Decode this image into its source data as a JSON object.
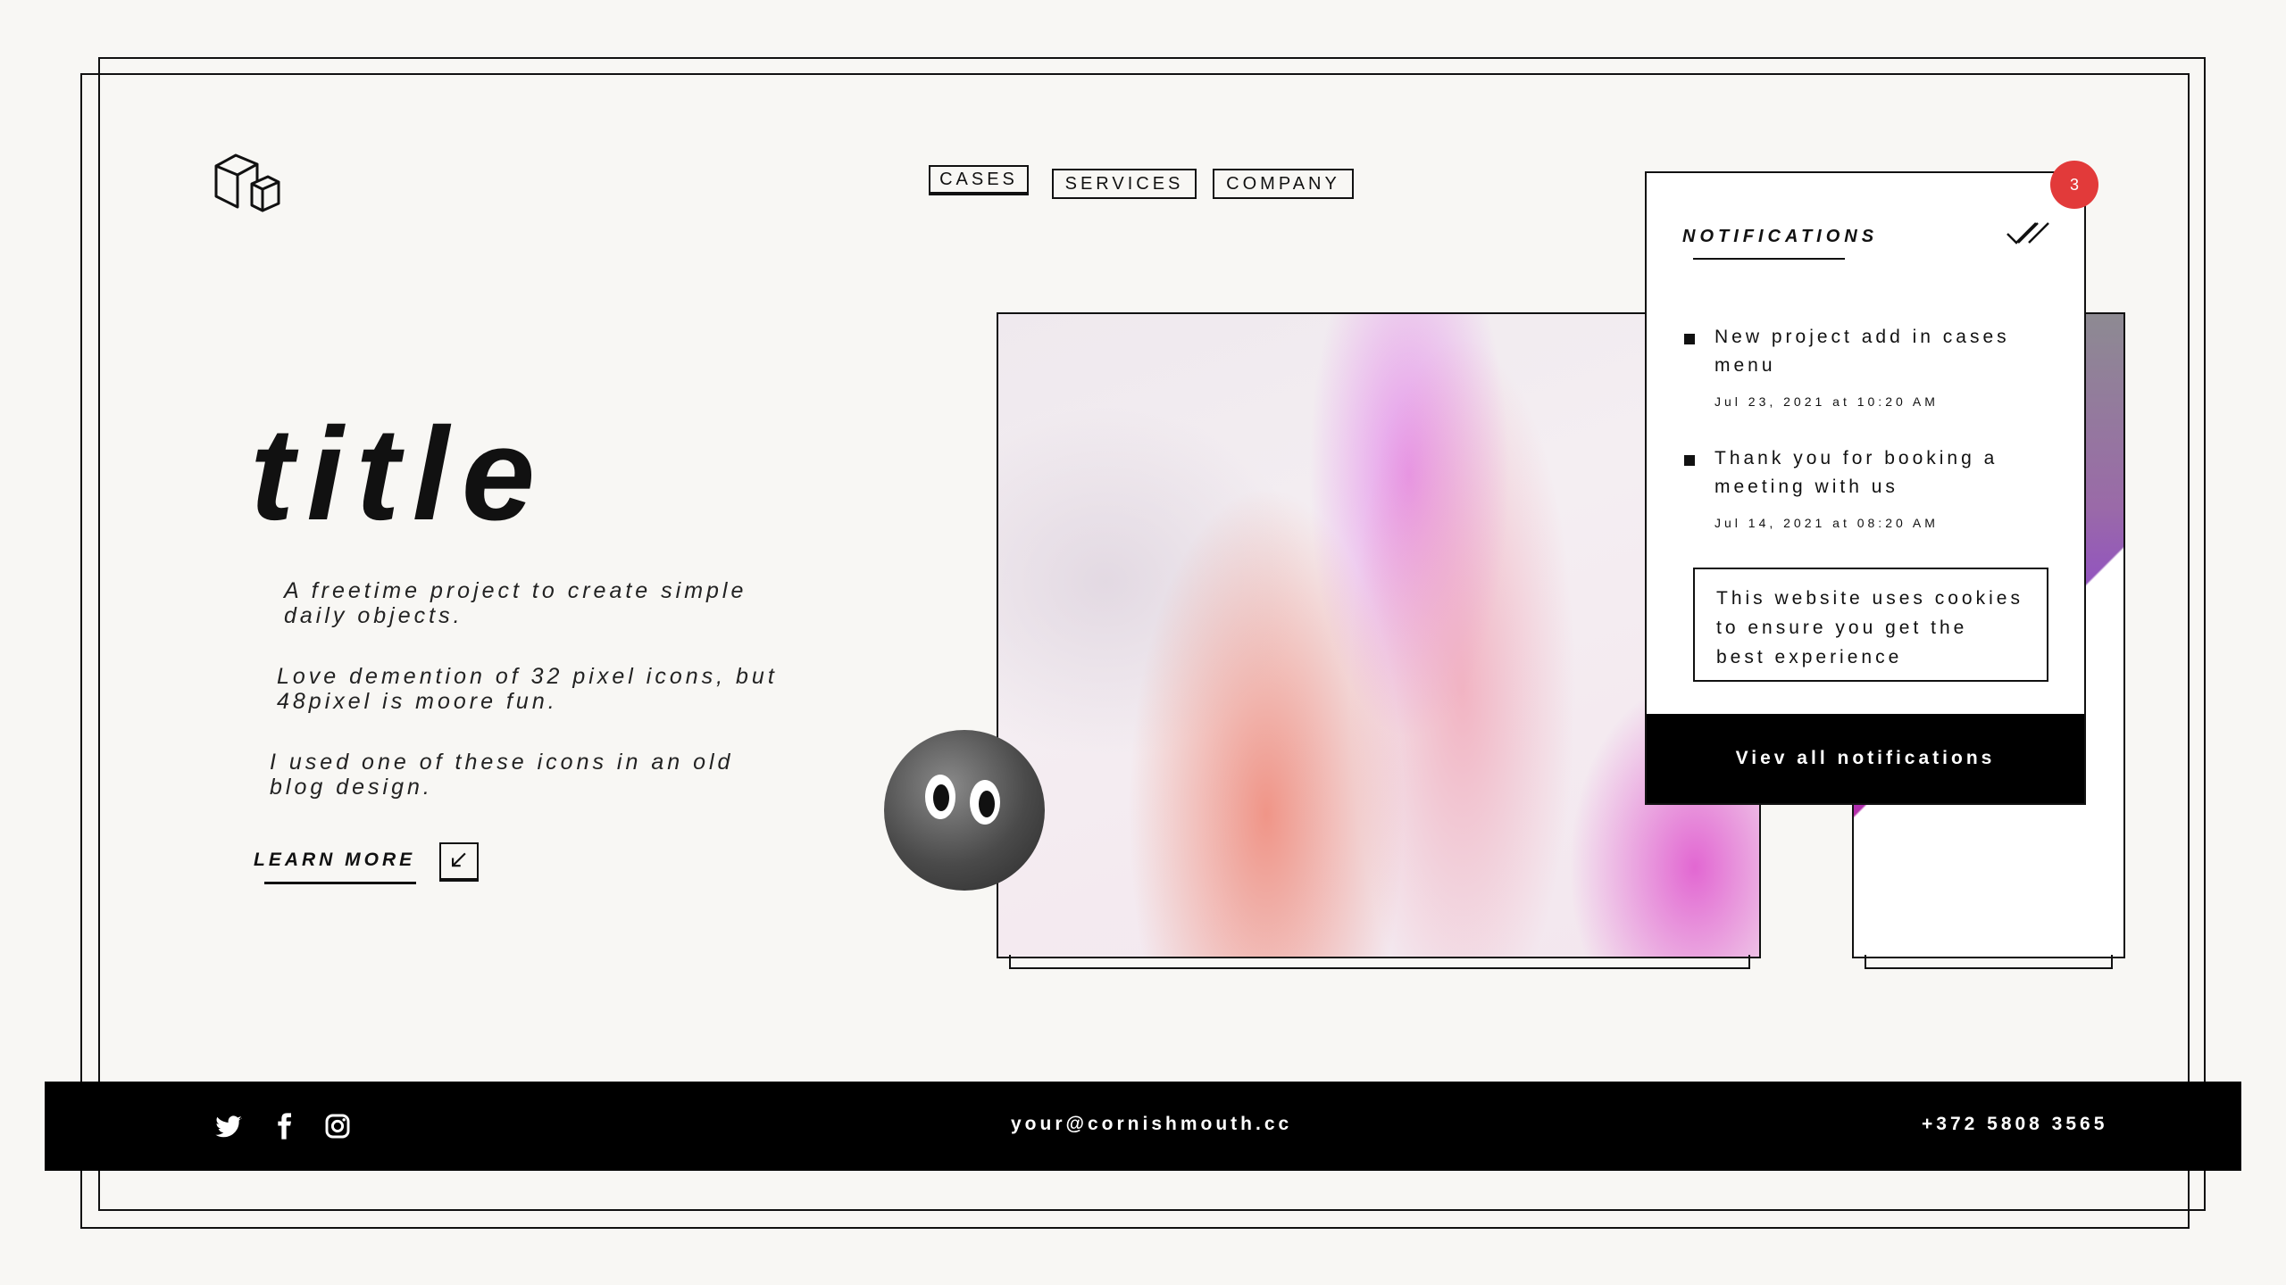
{
  "nav": {
    "cases": "CASES",
    "services": "SERVICES",
    "company": "COMPANY"
  },
  "hero": {
    "title": "title",
    "paragraphs": [
      "A freetime project to create simple daily objects.",
      "Love demention of 32 pixel icons, but 48pixel is moore fun.",
      "I used one of these icons in an old blog design."
    ],
    "learn_more": "LEARN MORE"
  },
  "notifications": {
    "title": "NOTIFICATIONS",
    "badge_count": "3",
    "items": [
      {
        "text": "New project add in cases menu",
        "date": "Jul 23, 2021 at 10:20 AM"
      },
      {
        "text": "Thank you for booking a meeting with us",
        "date": "Jul 14, 2021 at 08:20 AM"
      }
    ],
    "cookie_notice": "This website uses cookies to ensure you get the best experience",
    "view_all": "Viev all notifications"
  },
  "footer": {
    "email": "your@cornishmouth.cc",
    "phone": "+372 5808 3565",
    "social_icons": [
      "twitter-icon",
      "facebook-icon",
      "instagram-icon"
    ]
  },
  "colors": {
    "background": "#f8f7f4",
    "ink": "#111111",
    "badge": "#e23a3a"
  }
}
